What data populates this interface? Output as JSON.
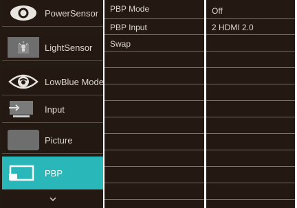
{
  "menu": {
    "items": [
      {
        "label": "PowerSensor",
        "icon": "eye-icon",
        "active": false
      },
      {
        "label": "LightSensor",
        "icon": "light-sensor-icon",
        "active": false
      },
      {
        "label": "LowBlue Mode",
        "icon": "eye-outline-icon",
        "active": false
      },
      {
        "label": "Input",
        "icon": "input-icon",
        "active": false
      },
      {
        "label": "Picture",
        "icon": "picture-icon",
        "active": false
      },
      {
        "label": "PBP",
        "icon": "pbp-icon",
        "active": true
      }
    ],
    "more_icon": "chevron-down-icon"
  },
  "submenu": {
    "items": [
      "PBP Mode",
      "PBP Input",
      "Swap"
    ]
  },
  "values": {
    "items": [
      "Off",
      "2 HDMI 2.0"
    ]
  },
  "colors": {
    "background": "#241912",
    "active": "#2ab7b9",
    "text": "#dcd6d0",
    "divider": "#ffffff"
  }
}
